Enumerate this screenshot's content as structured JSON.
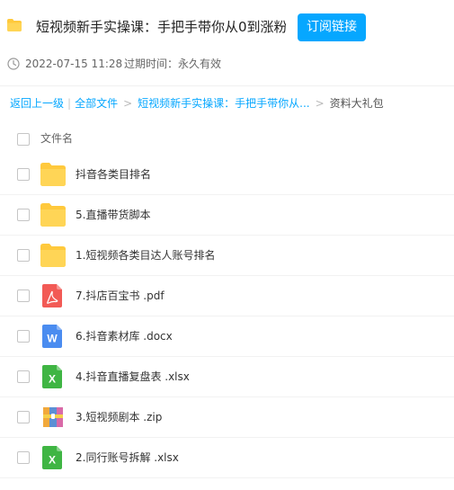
{
  "header": {
    "title": "短视频新手实操课：手把手带你从0到涨粉...",
    "subscribe_label": "订阅链接",
    "icon": "folder-icon"
  },
  "meta": {
    "date": "2022-07-15 11:28",
    "expire": "过期时间：永久有效",
    "icon": "clock-icon"
  },
  "breadcrumb": {
    "back": "返回上一级",
    "all_files": "全部文件",
    "parent": "短视频新手实操课：手把手带你从...",
    "current": "资料大礼包"
  },
  "list_header": {
    "column": "文件名"
  },
  "files": [
    {
      "name": "抖音各类目排名",
      "type": "folder"
    },
    {
      "name": "5.直播带货脚本",
      "type": "folder"
    },
    {
      "name": "1.短视频各类目达人账号排名",
      "type": "folder"
    },
    {
      "name": "7.抖店百宝书 .pdf",
      "type": "pdf"
    },
    {
      "name": "6.抖音素材库 .docx",
      "type": "docx"
    },
    {
      "name": "4.抖音直播复盘表 .xlsx",
      "type": "xlsx"
    },
    {
      "name": "3.短视频剧本 .zip",
      "type": "zip"
    },
    {
      "name": "2.同行账号拆解 .xlsx",
      "type": "xlsx"
    }
  ],
  "colors": {
    "accent": "#06a7ff",
    "folder": "#ffd04d",
    "pdf": "#f25a55",
    "docx": "#4a8cf0",
    "xlsx": "#3fb543"
  }
}
